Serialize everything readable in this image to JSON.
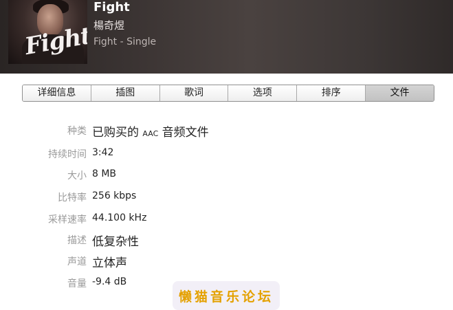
{
  "track": {
    "title": "Fight",
    "artist": "楊奇煜",
    "album": "Fight - Single",
    "artwork_text": "Fight"
  },
  "tabs": [
    {
      "label": "详细信息",
      "active": false
    },
    {
      "label": "插图",
      "active": false
    },
    {
      "label": "歌词",
      "active": false
    },
    {
      "label": "选项",
      "active": false
    },
    {
      "label": "排序",
      "active": false
    },
    {
      "label": "文件",
      "active": true
    }
  ],
  "details": {
    "kind": {
      "label": "种类",
      "value_pre": "已购买的 ",
      "value_small": "AAC",
      "value_post": " 音频文件"
    },
    "duration": {
      "label": "持续时间",
      "value": "3:42"
    },
    "size": {
      "label": "大小",
      "value": "8 MB"
    },
    "bit_rate": {
      "label": "比特率",
      "value": "256 kbps"
    },
    "sample_rate": {
      "label": "采样速率",
      "value": "44.100 kHz"
    },
    "profile": {
      "label": "描述",
      "value": "低复杂性"
    },
    "channels": {
      "label": "声道",
      "value": "立体声"
    },
    "volume": {
      "label": "音量",
      "value": "-9.4 dB"
    }
  },
  "watermark": "懒猫音乐论坛"
}
